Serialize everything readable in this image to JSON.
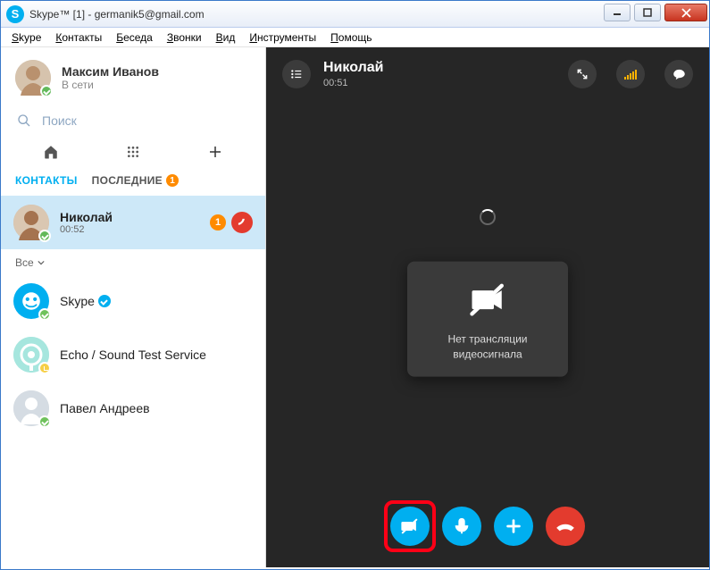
{
  "window": {
    "title": "Skype™ [1] - germanik5@gmail.com"
  },
  "menu": {
    "items": [
      "Skype",
      "Контакты",
      "Беседа",
      "Звонки",
      "Вид",
      "Инструменты",
      "Помощь"
    ]
  },
  "self": {
    "name": "Максим Иванов",
    "status": "В сети"
  },
  "search": {
    "placeholder": "Поиск"
  },
  "tabs": {
    "contacts": "КОНТАКТЫ",
    "recent": "ПОСЛЕДНИЕ",
    "recent_badge": "1"
  },
  "active_contact": {
    "name": "Николай",
    "time": "00:52",
    "badge": "1"
  },
  "filter": {
    "label": "Все"
  },
  "contacts": {
    "c1": "Skype",
    "c2": "Echo / Sound Test Service",
    "c3": "Павел Андреев"
  },
  "call": {
    "name": "Николай",
    "timer": "00:51",
    "no_video_line1": "Нет трансляции",
    "no_video_line2": "видеосигнала"
  }
}
